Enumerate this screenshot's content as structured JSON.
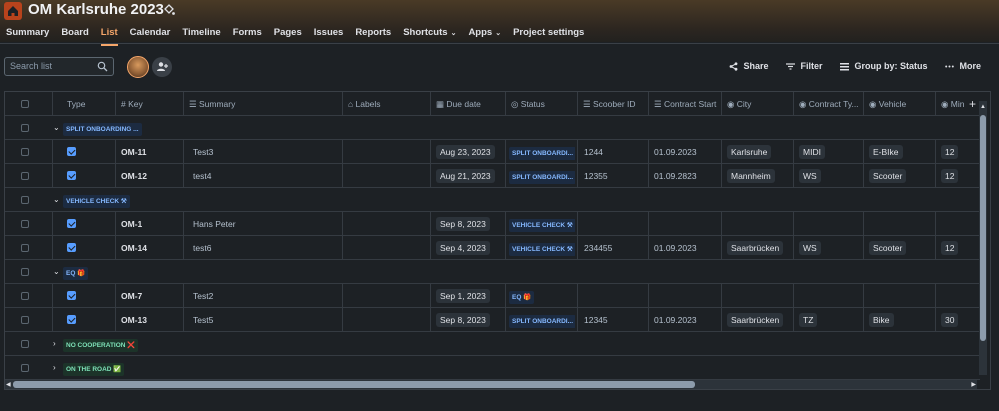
{
  "project": {
    "title": "OM Karlsruhe 2023"
  },
  "nav": [
    {
      "label": "Summary",
      "active": false,
      "caret": false
    },
    {
      "label": "Board",
      "active": false,
      "caret": false
    },
    {
      "label": "List",
      "active": true,
      "caret": false
    },
    {
      "label": "Calendar",
      "active": false,
      "caret": false
    },
    {
      "label": "Timeline",
      "active": false,
      "caret": false
    },
    {
      "label": "Forms",
      "active": false,
      "caret": false
    },
    {
      "label": "Pages",
      "active": false,
      "caret": false
    },
    {
      "label": "Issues",
      "active": false,
      "caret": false
    },
    {
      "label": "Reports",
      "active": false,
      "caret": false
    },
    {
      "label": "Shortcuts",
      "active": false,
      "caret": true
    },
    {
      "label": "Apps",
      "active": false,
      "caret": true
    },
    {
      "label": "Project settings",
      "active": false,
      "caret": false
    }
  ],
  "search": {
    "placeholder": "Search list"
  },
  "toolbar": {
    "share": "Share",
    "filter": "Filter",
    "group_by": "Group by: Status",
    "more": "More"
  },
  "columns": [
    "Type",
    "Key",
    "Summary",
    "Labels",
    "Due date",
    "Status",
    "Scoober ID",
    "Contract Start",
    "City",
    "Contract Ty...",
    "Vehicle",
    "Min"
  ],
  "rows": [
    {
      "kind": "group",
      "label": "SPLIT ONBOARDING ...",
      "expanded": true,
      "color": "#85b8ff",
      "bg": "#1c2b41"
    },
    {
      "kind": "issue",
      "key": "OM-11",
      "summary": "Test3",
      "due": "Aug 23, 2023",
      "status": "SPLIT ONBOARDI...",
      "scoober": "1244",
      "contract_start": "01.09.2023",
      "city": "Karlsruhe",
      "contract_type": "MIDI",
      "vehicle": "E-BIke",
      "min": "12"
    },
    {
      "kind": "issue",
      "key": "OM-12",
      "summary": "test4",
      "due": "Aug 21, 2023",
      "status": "SPLIT ONBOARDI...",
      "scoober": "12355",
      "contract_start": "01.09.2823",
      "city": "Mannheim",
      "contract_type": "WS",
      "vehicle": "Scooter",
      "min": "12"
    },
    {
      "kind": "group",
      "label": "VEHICLE CHECK ⚒",
      "expanded": true,
      "color": "#85b8ff",
      "bg": "#1c2b41"
    },
    {
      "kind": "issue",
      "key": "OM-1",
      "summary": "Hans Peter",
      "due": "Sep 8, 2023",
      "status": "VEHICLE CHECK ⚒",
      "scoober": "",
      "contract_start": "",
      "city": "",
      "contract_type": "",
      "vehicle": "",
      "min": ""
    },
    {
      "kind": "issue",
      "key": "OM-14",
      "summary": "test6",
      "due": "Sep 4, 2023",
      "status": "VEHICLE CHECK ⚒",
      "scoober": "234455",
      "contract_start": "01.09.2023",
      "city": "Saarbrücken",
      "contract_type": "WS",
      "vehicle": "Scooter",
      "min": "12"
    },
    {
      "kind": "group",
      "label": "EQ 🎁",
      "expanded": true,
      "color": "#85b8ff",
      "bg": "#1c2b41"
    },
    {
      "kind": "issue",
      "key": "OM-7",
      "summary": "Test2",
      "due": "Sep 1, 2023",
      "status": "EQ 🎁",
      "scoober": "",
      "contract_start": "",
      "city": "",
      "contract_type": "",
      "vehicle": "",
      "min": ""
    },
    {
      "kind": "issue",
      "key": "OM-13",
      "summary": "Test5",
      "due": "Sep 8, 2023",
      "status": "SPLIT ONBOARDI...",
      "scoober": "12345",
      "contract_start": "01.09.2023",
      "city": "Saarbrücken",
      "contract_type": "TZ",
      "vehicle": "Bike",
      "min": "30"
    },
    {
      "kind": "group",
      "label": "NO COOPERATION ❌",
      "expanded": false,
      "color": "#7ee2b8",
      "bg": "#1c3329"
    },
    {
      "kind": "group",
      "label": "ON THE ROAD ✅",
      "expanded": false,
      "color": "#7ee2b8",
      "bg": "#1c3329"
    }
  ]
}
